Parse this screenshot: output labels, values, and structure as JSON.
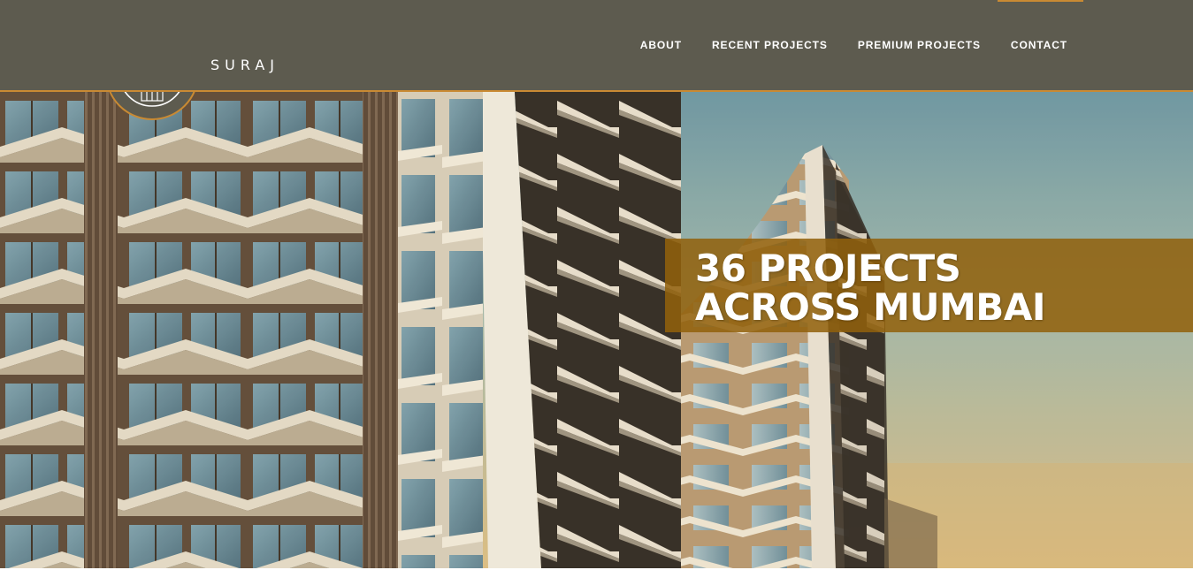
{
  "brand": {
    "name": "SURAJ",
    "logo_icon": "tree-building-logo-icon"
  },
  "nav": {
    "items": [
      {
        "label": "ABOUT"
      },
      {
        "label": "RECENT PROJECTS"
      },
      {
        "label": "PREMIUM PROJECTS"
      },
      {
        "label": "CONTACT"
      }
    ]
  },
  "hero": {
    "headline_line1": "36 PROJECTS",
    "headline_line2": "ACROSS MUMBAI",
    "image": "high-rise-residential-towers-photo"
  },
  "colors": {
    "header_bg": "#5d5b4f",
    "accent": "#c98a33",
    "banner": "#92610c",
    "text": "#ffffff"
  }
}
